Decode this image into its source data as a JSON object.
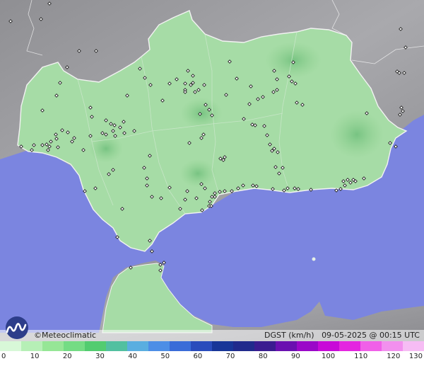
{
  "brand": {
    "name": "Meteoclimatic",
    "symbol": "©"
  },
  "info": {
    "variable": "DGST (km/h)",
    "timestamp": "09-05-2025 @ 00:15 UTC"
  },
  "legend": {
    "ticks": [
      "0",
      "10",
      "20",
      "30",
      "40",
      "50",
      "60",
      "70",
      "80",
      "90",
      "100",
      "110",
      "120",
      "130"
    ],
    "colors": [
      "#d8f8d8",
      "#b6efb6",
      "#96e696",
      "#74dc84",
      "#52cc70",
      "#52c0a0",
      "#5aaee0",
      "#4d8ee6",
      "#3a6cd8",
      "#2a4cbc",
      "#183698",
      "#202a8c",
      "#3a1c90",
      "#6a10b0",
      "#9a08c8",
      "#c80ad8",
      "#e426e0",
      "#f060e8",
      "#f290ee",
      "#f6bcf4"
    ]
  },
  "colors": {
    "sea": "#7b85e0",
    "land_gray": "#9a9a9e",
    "region_fill": "#a6dca6",
    "region_dark": "#8ccf8c"
  },
  "stations_count": 170
}
